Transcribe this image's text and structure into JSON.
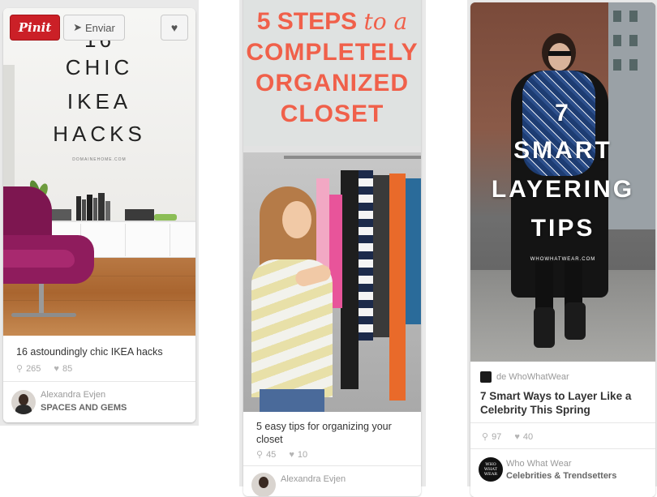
{
  "buttons": {
    "pin_it": "Pinit",
    "send": "Enviar"
  },
  "pins": [
    {
      "image": {
        "line1": "16",
        "line2": "CHIC",
        "line3": "IKEA",
        "line4": "HACKS",
        "credit": "DOMAINEHOME.COM"
      },
      "description": "16 astoundingly chic IKEA hacks",
      "repins": "265",
      "likes": "85",
      "owner": "Alexandra Evjen",
      "board": "SPACES AND GEMS"
    },
    {
      "image": {
        "line1": "5 STEPS",
        "line1b": "to a",
        "line2": "COMPLETELY",
        "line3": "ORGANIZED",
        "line4": "CLOSET"
      },
      "description": "5 easy tips for organizing your closet",
      "repins": "45",
      "likes": "10",
      "owner": "Alexandra Evjen"
    },
    {
      "image": {
        "line1": "7",
        "line2": "SMART",
        "line3": "LAYERING",
        "line4": "TIPS",
        "credit": "WHOWHATWEAR.COM"
      },
      "source": "de WhoWhatWear",
      "title": "7 Smart Ways to Layer Like a Celebrity This Spring",
      "repins": "97",
      "likes": "40",
      "owner": "Who What Wear",
      "board": "Celebrities & Trendsetters",
      "avatar_text": "WHO WHAT WEAR"
    }
  ],
  "colors": {
    "pin_red": "#cb2027",
    "closet_title": "#f0604a"
  }
}
